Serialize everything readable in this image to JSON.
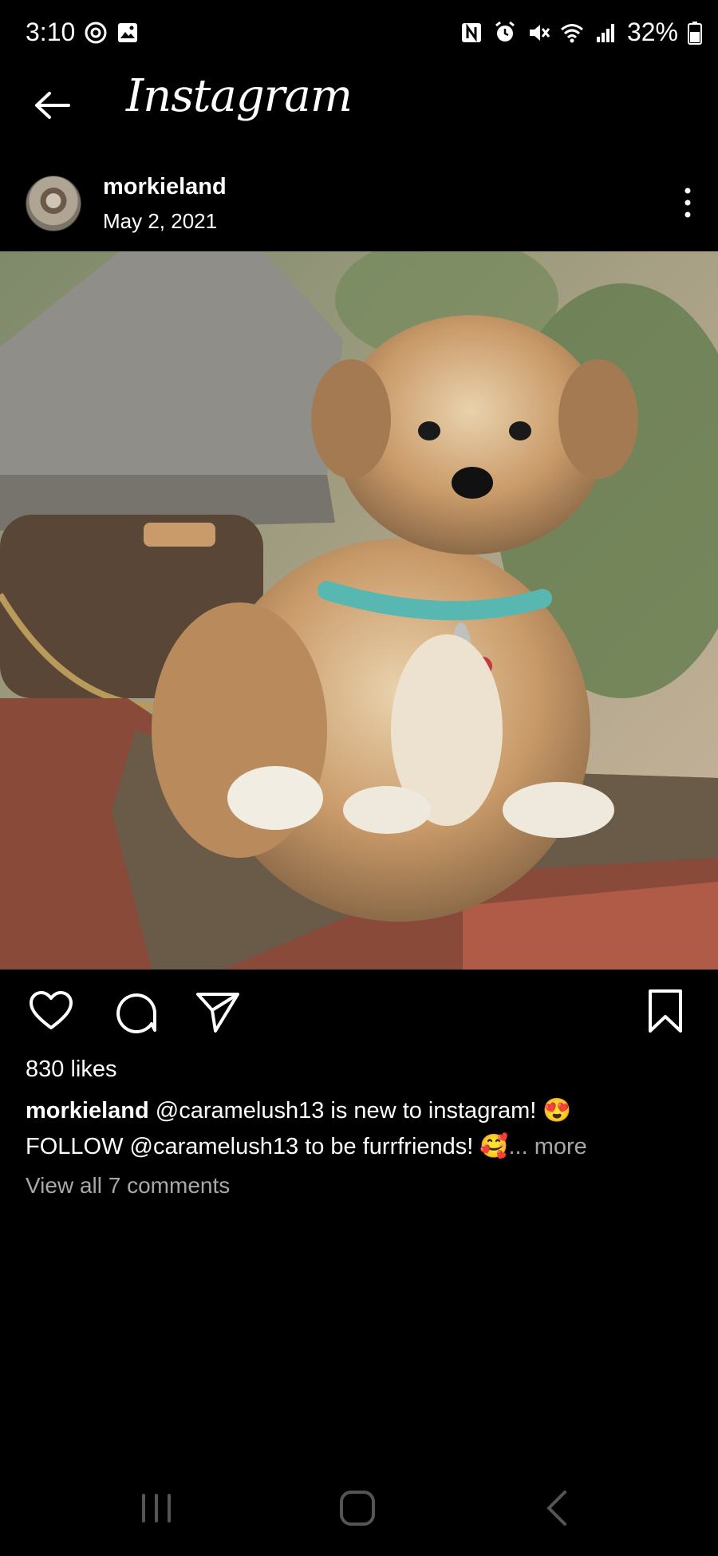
{
  "status_bar": {
    "time": "3:10",
    "battery": "32%",
    "left_icons": [
      "threads-icon",
      "image-icon"
    ],
    "right_icons": [
      "nfc-icon",
      "alarm-icon",
      "mute-icon",
      "wifi-icon",
      "signal-icon",
      "battery-icon"
    ]
  },
  "header": {
    "title": "Instagram"
  },
  "post": {
    "username": "morkieland",
    "date": "May 2, 2021",
    "likes": "830 likes",
    "caption_user": "morkieland",
    "caption_line1": "@caramelush13 is new to instagram! 😍",
    "caption_line2": "FOLLOW @caramelush13 to be furrfriends! 🥰",
    "caption_more": "... more",
    "view_comments": "View all 7 comments"
  },
  "colors": {
    "background": "#000000",
    "text": "#ffffff",
    "secondary_text": "#a8a8a8"
  }
}
